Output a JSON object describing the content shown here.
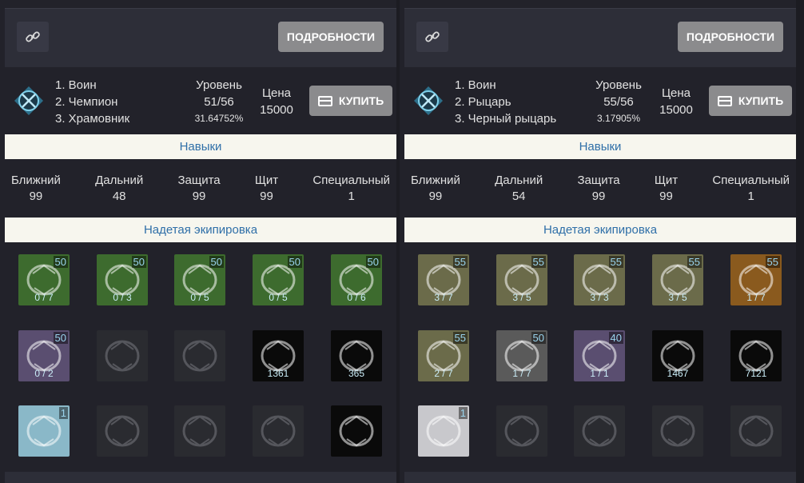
{
  "colors": {
    "background": "#22222a",
    "button": "#8b8b8d",
    "section_bar": "#f7f6ee",
    "section_text": "#2f6fa8",
    "level_badge": "#9ad4ee"
  },
  "columns": [
    {
      "link_icon": "link-icon",
      "details_label": "ПОДРОБНОСТИ",
      "class_icon": "class-emblem-icon",
      "classes": [
        "1. Воин",
        "2. Чемпион",
        "3. Храмовник"
      ],
      "level_label": "Уровень",
      "level_value": "51/56",
      "level_percent": "31.64752%",
      "price_label": "Цена",
      "price_value": "15000",
      "buy_label": "КУПИТЬ",
      "skills_title": "Навыки",
      "skills": [
        {
          "name": "Ближний",
          "value": "99"
        },
        {
          "name": "Дальний",
          "value": "48"
        },
        {
          "name": "Защита",
          "value": "99"
        },
        {
          "name": "Щит",
          "value": "99"
        },
        {
          "name": "Специальный",
          "value": "1"
        }
      ],
      "equipment_title": "Надетая экипировка",
      "equipment": [
        [
          {
            "icon": "helmet-icon",
            "level": "50",
            "count": "0 / 7",
            "color": "#3d6b2e",
            "empty": false
          },
          {
            "icon": "chest-armor-icon",
            "level": "50",
            "count": "0 / 3",
            "color": "#3d6b2e",
            "empty": false
          },
          {
            "icon": "gloves-icon",
            "level": "50",
            "count": "0 / 5",
            "color": "#3d6b2e",
            "empty": false
          },
          {
            "icon": "boots-icon",
            "level": "50",
            "count": "0 / 5",
            "color": "#3d6b2e",
            "empty": false
          },
          {
            "icon": "shield-icon",
            "level": "50",
            "count": "0 / 6",
            "color": "#3d6b2e",
            "empty": false
          }
        ],
        [
          {
            "icon": "sword-icon",
            "level": "50",
            "count": "0 / 2",
            "color": "#5a4e70",
            "empty": false
          },
          {
            "icon": "weapon-slot-empty-icon",
            "level": "",
            "count": "",
            "color": "#2a2b30",
            "empty": true
          },
          {
            "icon": "cloak-slot-empty-icon",
            "level": "",
            "count": "",
            "color": "#2a2b30",
            "empty": true
          },
          {
            "icon": "bolt-ammo-icon",
            "level": "",
            "count": "1361",
            "color": "#0a0a0a",
            "empty": false
          },
          {
            "icon": "arrows-ammo-icon",
            "level": "",
            "count": "365",
            "color": "#0a0a0a",
            "empty": false
          }
        ],
        [
          {
            "icon": "ring-icon",
            "level": "1",
            "count": "",
            "color": "#8ab8c8",
            "empty": false
          },
          {
            "icon": "ring-slot-empty-icon",
            "level": "",
            "count": "",
            "color": "#2a2b30",
            "empty": true
          },
          {
            "icon": "gem-slot-empty-icon",
            "level": "",
            "count": "",
            "color": "#2a2b30",
            "empty": true
          },
          {
            "icon": "gem-slot-empty-icon",
            "level": "",
            "count": "",
            "color": "#2a2b30",
            "empty": true
          },
          {
            "icon": "arrows-ammo-icon",
            "level": "",
            "count": "",
            "color": "#0a0a0a",
            "empty": false
          }
        ]
      ]
    },
    {
      "link_icon": "link-icon",
      "details_label": "ПОДРОБНОСТИ",
      "class_icon": "class-emblem-icon",
      "classes": [
        "1. Воин",
        "2. Рыцарь",
        "3. Черный рыцарь"
      ],
      "level_label": "Уровень",
      "level_value": "55/56",
      "level_percent": "3.17905%",
      "price_label": "Цена",
      "price_value": "15000",
      "buy_label": "КУПИТЬ",
      "skills_title": "Навыки",
      "skills": [
        {
          "name": "Ближний",
          "value": "99"
        },
        {
          "name": "Дальний",
          "value": "54"
        },
        {
          "name": "Защита",
          "value": "99"
        },
        {
          "name": "Щит",
          "value": "99"
        },
        {
          "name": "Специальный",
          "value": "1"
        }
      ],
      "equipment_title": "Надетая экипировка",
      "equipment": [
        [
          {
            "icon": "helmet-icon",
            "level": "55",
            "count": "3 / 7",
            "color": "#6b6b4a",
            "empty": false
          },
          {
            "icon": "chest-armor-icon",
            "level": "55",
            "count": "3 / 5",
            "color": "#6b6b4a",
            "empty": false
          },
          {
            "icon": "gloves-icon",
            "level": "55",
            "count": "3 / 3",
            "color": "#6b6b4a",
            "empty": false
          },
          {
            "icon": "boots-icon",
            "level": "55",
            "count": "3 / 5",
            "color": "#6b6b4a",
            "empty": false
          },
          {
            "icon": "shield-icon",
            "level": "55",
            "count": "1 / 7",
            "color": "#8a5a1e",
            "empty": false
          }
        ],
        [
          {
            "icon": "sword-icon",
            "level": "55",
            "count": "2 / 7",
            "color": "#6b6b4a",
            "empty": false
          },
          {
            "icon": "crossbow-icon",
            "level": "50",
            "count": "1 / 7",
            "color": "#5a5a5a",
            "empty": false
          },
          {
            "icon": "cloak-icon",
            "level": "40",
            "count": "1 / 1",
            "color": "#5a4e70",
            "empty": false
          },
          {
            "icon": "bolt-ammo-icon",
            "level": "",
            "count": "1467",
            "color": "#0a0a0a",
            "empty": false
          },
          {
            "icon": "arrows-ammo-icon",
            "level": "",
            "count": "7121",
            "color": "#0a0a0a",
            "empty": false
          }
        ],
        [
          {
            "icon": "gem-icon",
            "level": "1",
            "count": "",
            "color": "#c8c8cc",
            "empty": false
          },
          {
            "icon": "ring-slot-empty-icon",
            "level": "",
            "count": "",
            "color": "#2a2b30",
            "empty": true
          },
          {
            "icon": "gem-slot-empty-icon",
            "level": "",
            "count": "",
            "color": "#2a2b30",
            "empty": true
          },
          {
            "icon": "gem-slot-empty-icon",
            "level": "",
            "count": "",
            "color": "#2a2b30",
            "empty": true
          },
          {
            "icon": "gem-slot-empty-icon",
            "level": "",
            "count": "",
            "color": "#2a2b30",
            "empty": true
          }
        ]
      ]
    }
  ]
}
